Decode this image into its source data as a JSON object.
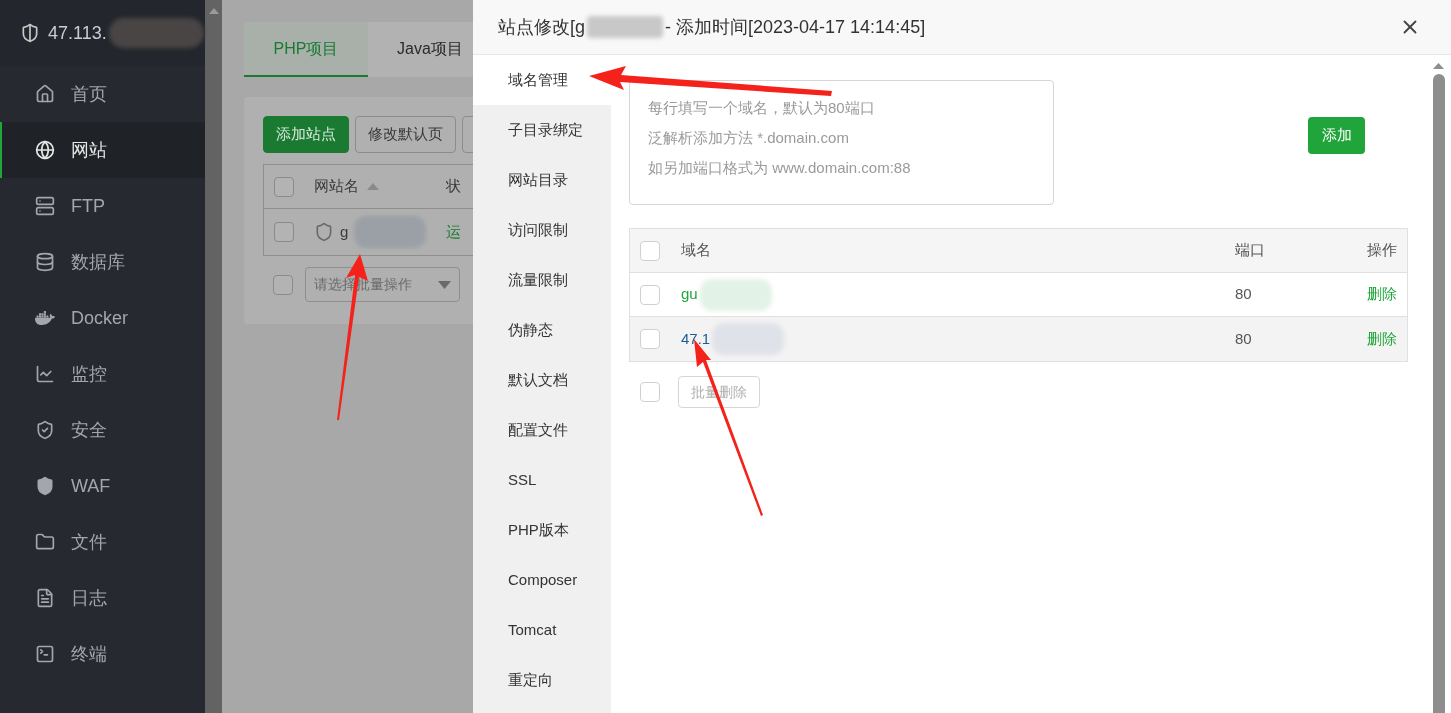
{
  "sidebar": {
    "title": "47.113.",
    "items": [
      {
        "label": "首页",
        "kind": "home",
        "selected": false
      },
      {
        "label": "网站",
        "kind": "globe",
        "selected": true
      },
      {
        "label": "FTP",
        "kind": "ftp",
        "selected": false
      },
      {
        "label": "数据库",
        "kind": "database",
        "selected": false
      },
      {
        "label": "Docker",
        "kind": "docker",
        "selected": false
      },
      {
        "label": "监控",
        "kind": "monitor",
        "selected": false
      },
      {
        "label": "安全",
        "kind": "security",
        "selected": false
      },
      {
        "label": "WAF",
        "kind": "waf",
        "selected": false
      },
      {
        "label": "文件",
        "kind": "folder",
        "selected": false
      },
      {
        "label": "日志",
        "kind": "log",
        "selected": false
      },
      {
        "label": "终端",
        "kind": "terminal",
        "selected": false
      }
    ]
  },
  "background": {
    "tabs": [
      {
        "label": "PHP项目",
        "selected": true
      },
      {
        "label": "Java项目",
        "selected": false
      }
    ],
    "buttons": [
      {
        "label": "添加站点",
        "kind": "primary"
      },
      {
        "label": "修改默认页",
        "kind": "default"
      }
    ],
    "table": {
      "select_all": {
        "checked": false
      },
      "columns": [
        "网站名",
        "状"
      ],
      "rows": [
        {
          "name": "g",
          "status": "运",
          "checked": false
        }
      ]
    },
    "batch_select": {
      "checked": false,
      "placeholder": "请选择批量操作"
    }
  },
  "dialog": {
    "title": "站点修改[g",
    "title_suffix": "- 添加时间[2023-04-17 14:14:45]",
    "nav": [
      {
        "label": "域名管理",
        "selected": true
      },
      {
        "label": "子目录绑定",
        "selected": false
      },
      {
        "label": "网站目录",
        "selected": false
      },
      {
        "label": "访问限制",
        "selected": false
      },
      {
        "label": "流量限制",
        "selected": false
      },
      {
        "label": "伪静态",
        "selected": false
      },
      {
        "label": "默认文档",
        "selected": false
      },
      {
        "label": "配置文件",
        "selected": false
      },
      {
        "label": "SSL",
        "selected": false
      },
      {
        "label": "PHP版本",
        "selected": false
      },
      {
        "label": "Composer",
        "selected": false
      },
      {
        "label": "Tomcat",
        "selected": false
      },
      {
        "label": "重定向",
        "selected": false
      }
    ],
    "domain_input": {
      "placeholder_lines": [
        "每行填写一个域名，默认为80端口",
        "泛解析添加方法 *.domain.com",
        "如另加端口格式为 www.domain.com:88"
      ]
    },
    "add_button": "添加",
    "table": {
      "select_all": {
        "checked": false
      },
      "columns": [
        "域名",
        "端口",
        "操作"
      ],
      "rows": [
        {
          "domain": "gu",
          "color": "#20a53a",
          "port": "80",
          "action": "删除",
          "checked": false,
          "selected": false
        },
        {
          "domain": "47.1",
          "color": "#1f5c8f",
          "port": "80",
          "action": "删除",
          "checked": false,
          "selected": true
        }
      ]
    },
    "batch": {
      "checked": false,
      "label": "批量删除",
      "disabled": true
    }
  }
}
